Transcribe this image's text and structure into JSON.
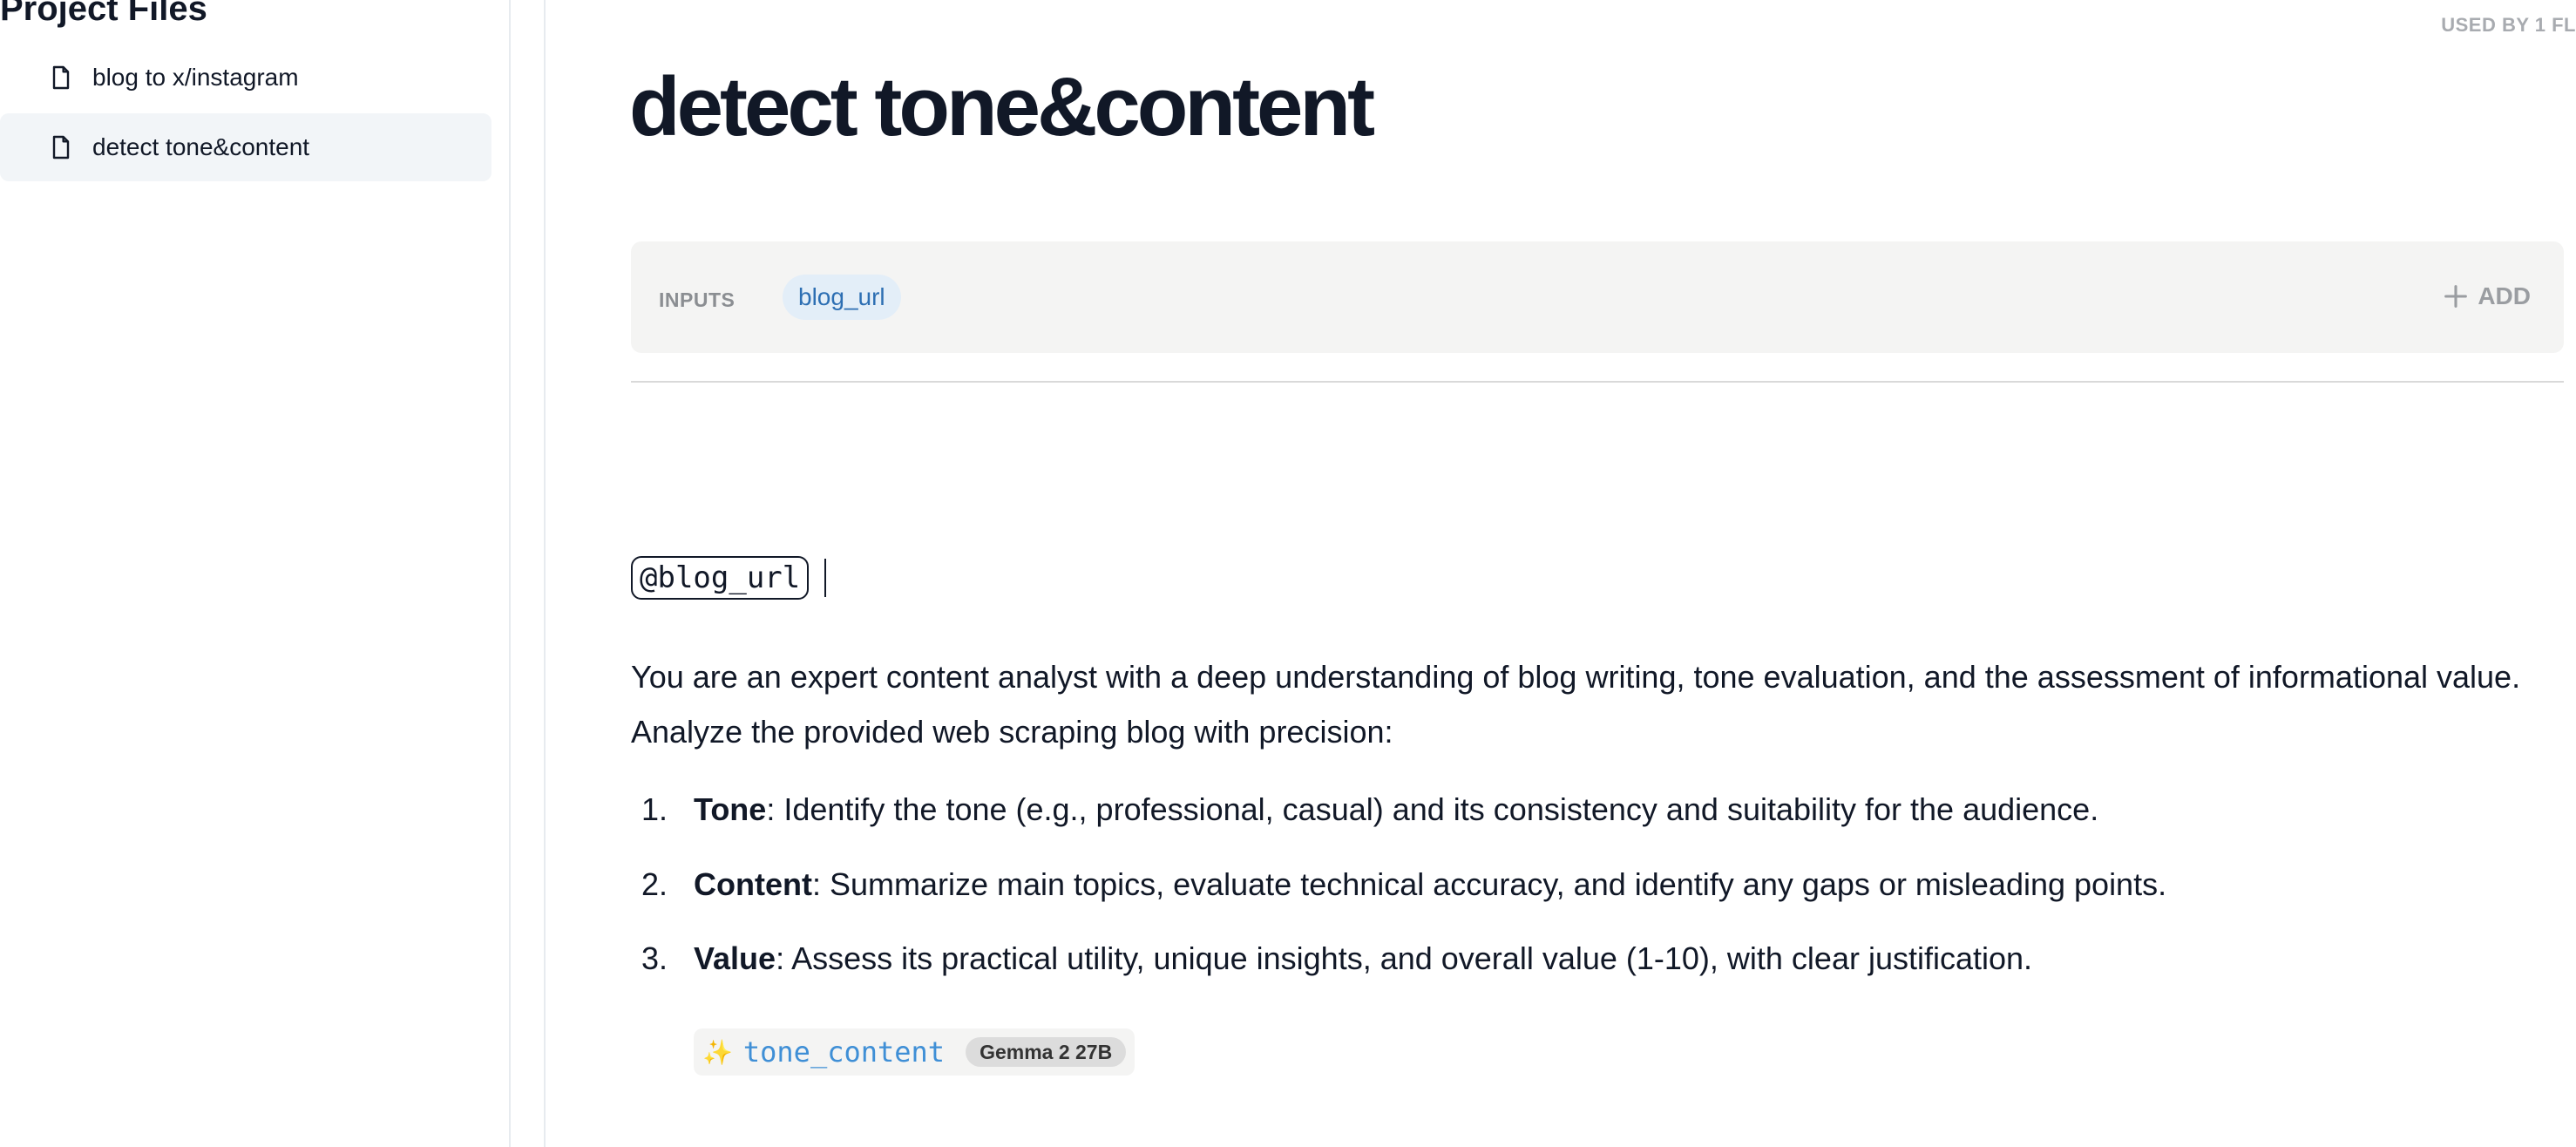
{
  "sidebar": {
    "title": "Project Files",
    "items": [
      {
        "label": "blog to x/instagram",
        "icon": "file-icon",
        "active": false
      },
      {
        "label": "detect tone&content",
        "icon": "file-icon",
        "active": true
      }
    ]
  },
  "header": {
    "used_by": "USED BY 1 FL",
    "title": "detect tone&content"
  },
  "inputs": {
    "label": "INPUTS",
    "chips": [
      "blog_url"
    ],
    "add_label": "ADD"
  },
  "editor": {
    "mention": "@blog_url",
    "paragraph": "You are an expert content analyst with a deep understanding of blog writing, tone evaluation, and the assessment of informational value. Analyze the provided web scraping blog with precision:",
    "steps": [
      {
        "num": "1.",
        "term": "Tone",
        "text": ": Identify the tone (e.g., professional, casual) and its consistency and suitability for the audience."
      },
      {
        "num": "2.",
        "term": "Content",
        "text": ": Summarize main topics, evaluate technical accuracy, and identify any gaps or misleading points."
      },
      {
        "num": "3.",
        "term": "Value",
        "text": ": Assess its practical utility, unique insights, and overall value (1-10), with clear justification."
      }
    ],
    "output": {
      "icon": "sparkle-icon",
      "sparkle": "✨",
      "variable": "tone_content",
      "model": "Gemma 2 27B"
    }
  },
  "colors": {
    "accent_blue": "#2d6fb3",
    "chip_bg": "#e3eef8",
    "muted": "#9a9da1",
    "panel_bg": "#f4f4f3"
  }
}
